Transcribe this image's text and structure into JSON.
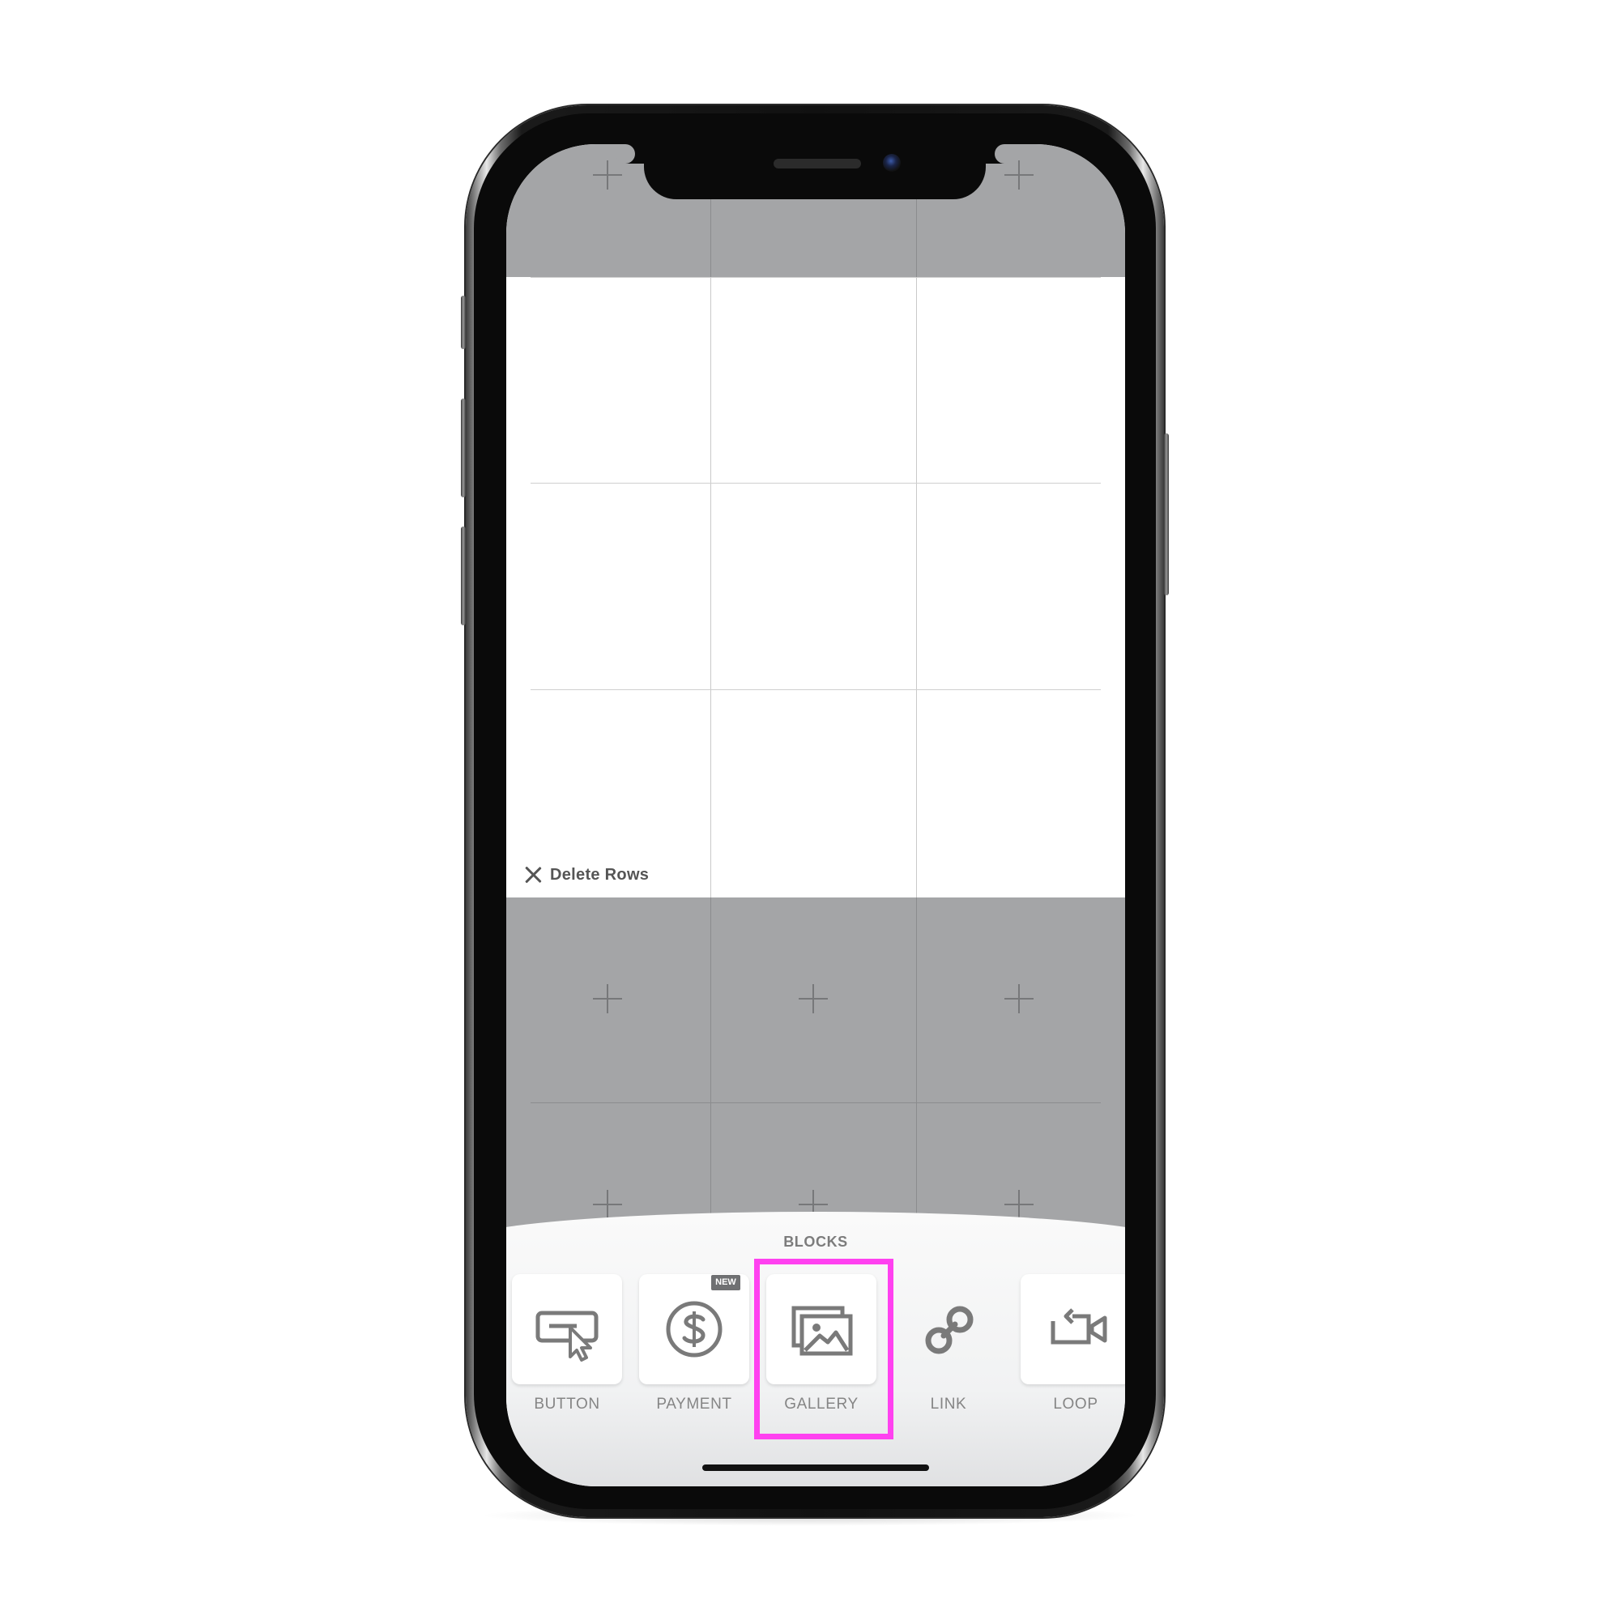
{
  "editor": {
    "delete_rows_label": "Delete Rows"
  },
  "blocks_panel": {
    "title": "BLOCKS",
    "new_badge": "NEW",
    "items": [
      {
        "label": "BUTTON",
        "icon": "button-cursor-icon"
      },
      {
        "label": "PAYMENT",
        "icon": "dollar-icon"
      },
      {
        "label": "GALLERY",
        "icon": "gallery-icon"
      },
      {
        "label": "LINK",
        "icon": "link-icon"
      },
      {
        "label": "LOOP",
        "icon": "loop-video-icon"
      }
    ],
    "selected": "GALLERY"
  },
  "colors": {
    "highlight": "#ff41f0",
    "empty_cell": "#a4a5a7",
    "icon": "#7a7a7a"
  }
}
